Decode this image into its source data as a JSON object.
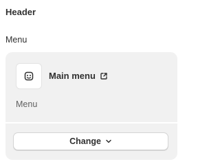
{
  "header": {
    "title": "Header"
  },
  "menu_field": {
    "label": "Menu",
    "selected_menu": {
      "name": "Main menu",
      "subtitle": "Menu",
      "icon": "menu-icon",
      "link_icon": "external-link-icon"
    },
    "change_button": {
      "label": "Change",
      "icon": "chevron-down-icon"
    }
  },
  "colors": {
    "card_background": "#f1f1f1",
    "text_primary": "#303030",
    "text_secondary": "#616161",
    "button_border": "#d4d4d4"
  }
}
